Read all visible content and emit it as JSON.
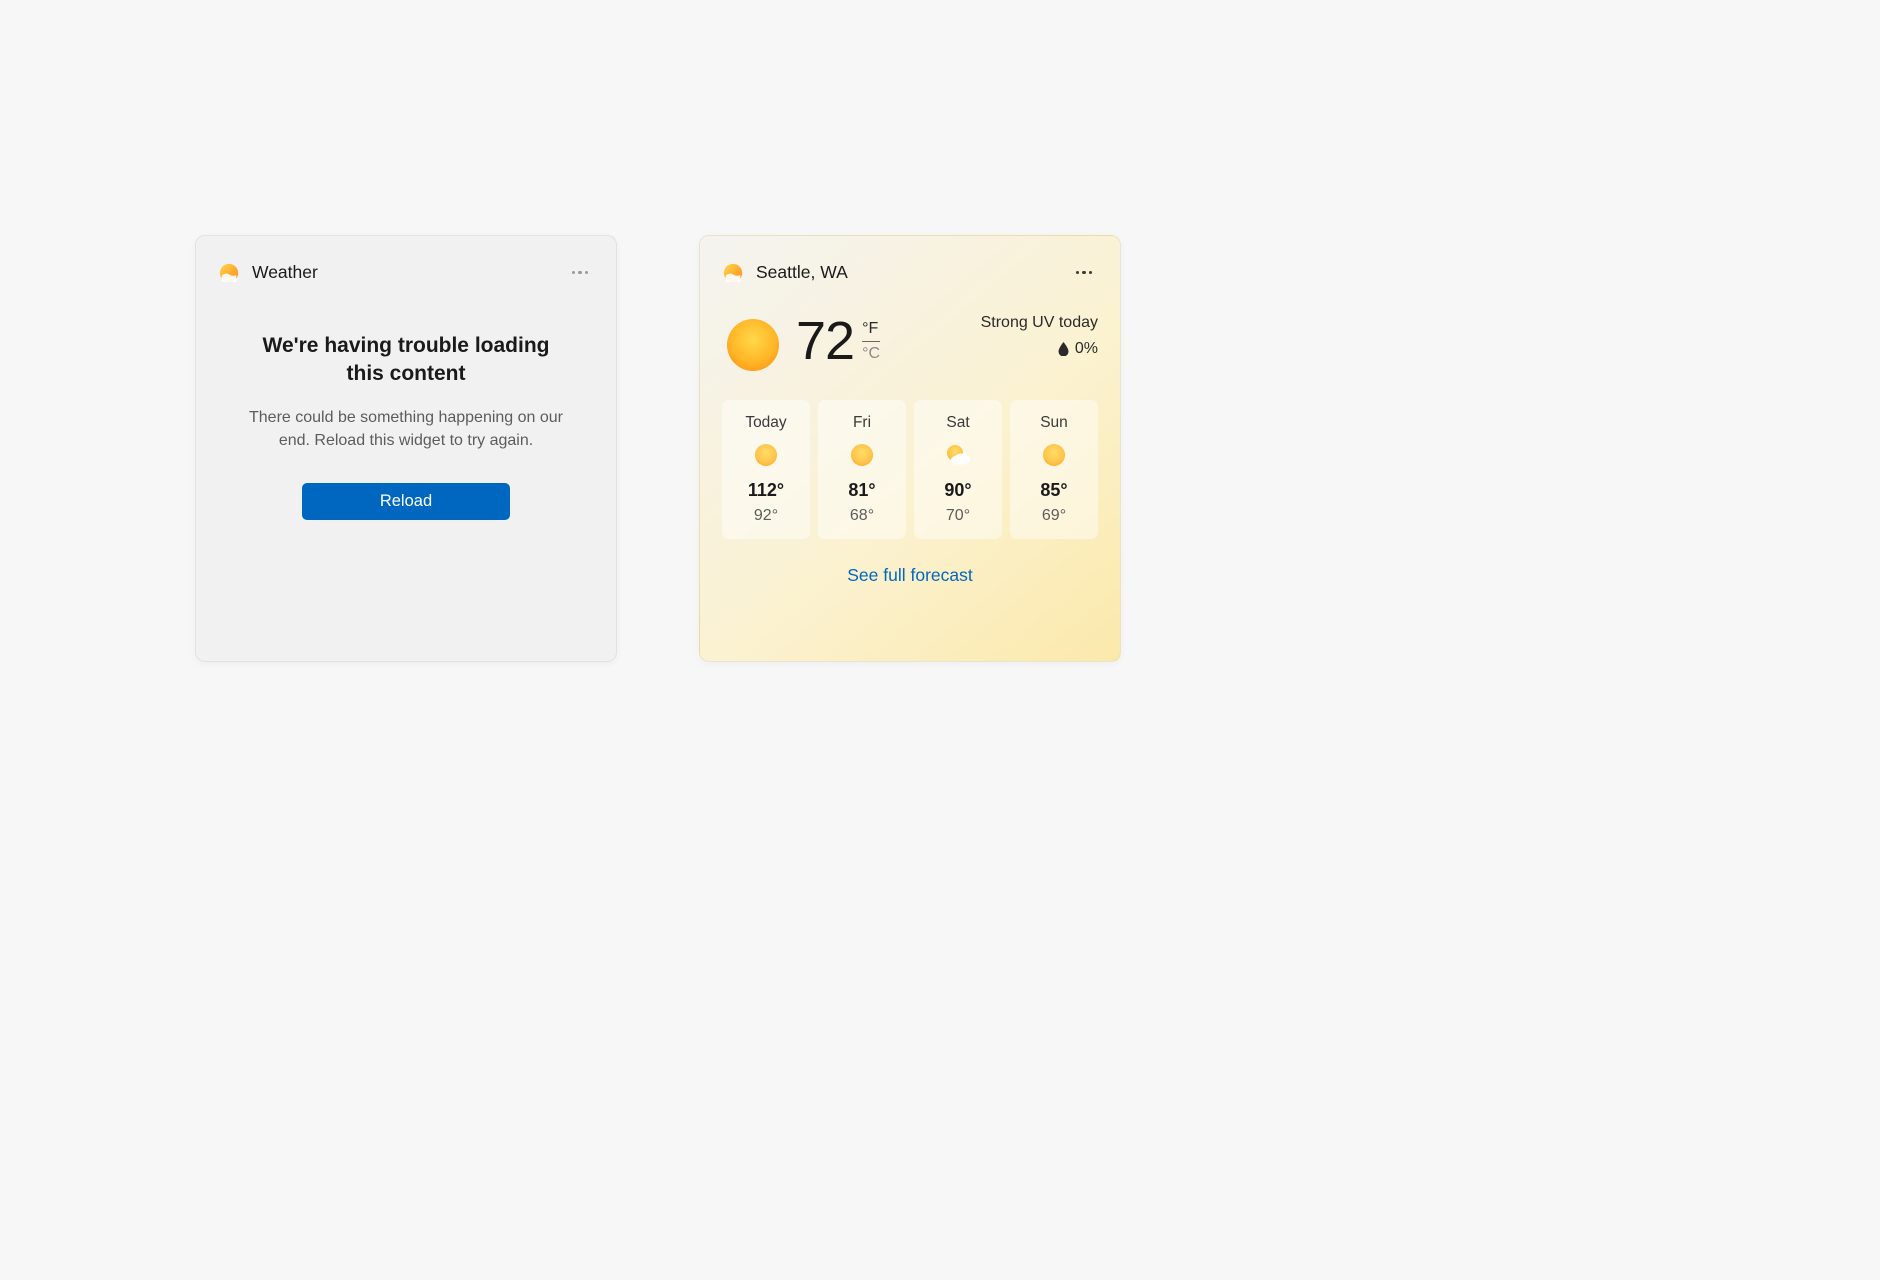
{
  "error_card": {
    "title": "Weather",
    "heading": "We're having trouble loading this content",
    "description": "There could be something happening on our end. Reload this widget to try again.",
    "reload_label": "Reload"
  },
  "weather_card": {
    "location": "Seattle, WA",
    "current_temp": "72",
    "unit_f": "°F",
    "unit_c": "°C",
    "uv_text": "Strong UV today",
    "precip": "0%",
    "forecast_link": "See full forecast",
    "days": [
      {
        "name": "Today",
        "high": "112°",
        "low": "92°",
        "icon": "sunny"
      },
      {
        "name": "Fri",
        "high": "81°",
        "low": "68°",
        "icon": "sunny"
      },
      {
        "name": "Sat",
        "high": "90°",
        "low": "70°",
        "icon": "partly-cloudy"
      },
      {
        "name": "Sun",
        "high": "85°",
        "low": "69°",
        "icon": "sunny"
      }
    ]
  }
}
